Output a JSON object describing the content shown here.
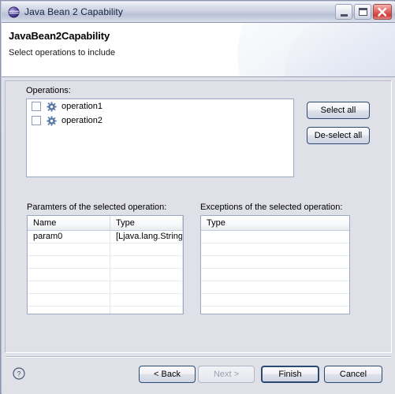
{
  "window": {
    "title": "Java Bean 2 Capability",
    "icon": "java-bean-icon",
    "controls": {
      "minimize": "minimize-button",
      "maximize": "maximize-button",
      "close": "close-button"
    }
  },
  "header": {
    "title": "JavaBean2Capability",
    "subtitle": "Select operations to include"
  },
  "operations_section": {
    "label": "Operations:",
    "items": [
      {
        "label": "operation1",
        "checked": false,
        "icon": "gear-icon"
      },
      {
        "label": "operation2",
        "checked": false,
        "icon": "gear-icon"
      }
    ],
    "select_all_label": "Select all",
    "deselect_all_label": "De-select all"
  },
  "parameters_section": {
    "label": "Paramters of the selected operation:",
    "columns": [
      "Name",
      "Type"
    ],
    "rows": [
      [
        "param0",
        "[Ljava.lang.String;"
      ],
      [
        "",
        ""
      ],
      [
        "",
        ""
      ],
      [
        "",
        ""
      ],
      [
        "",
        ""
      ],
      [
        "",
        ""
      ],
      [
        "",
        ""
      ]
    ]
  },
  "exceptions_section": {
    "label": "Exceptions of the selected operation:",
    "columns": [
      "Type"
    ],
    "rows": [
      [
        ""
      ],
      [
        ""
      ],
      [
        ""
      ],
      [
        ""
      ],
      [
        ""
      ],
      [
        ""
      ],
      [
        ""
      ]
    ]
  },
  "footer": {
    "help_icon": "help-icon",
    "buttons": {
      "back": "< Back",
      "next": "Next >",
      "finish": "Finish",
      "cancel": "Cancel"
    },
    "next_enabled": false,
    "default_button": "Finish"
  },
  "colors": {
    "accent_border": "#2b4a72",
    "body_background": "#dfe0e8",
    "header_background": "#ffffff",
    "close_button": "#cf3b37",
    "gear_icon": "#5b7ba6"
  }
}
